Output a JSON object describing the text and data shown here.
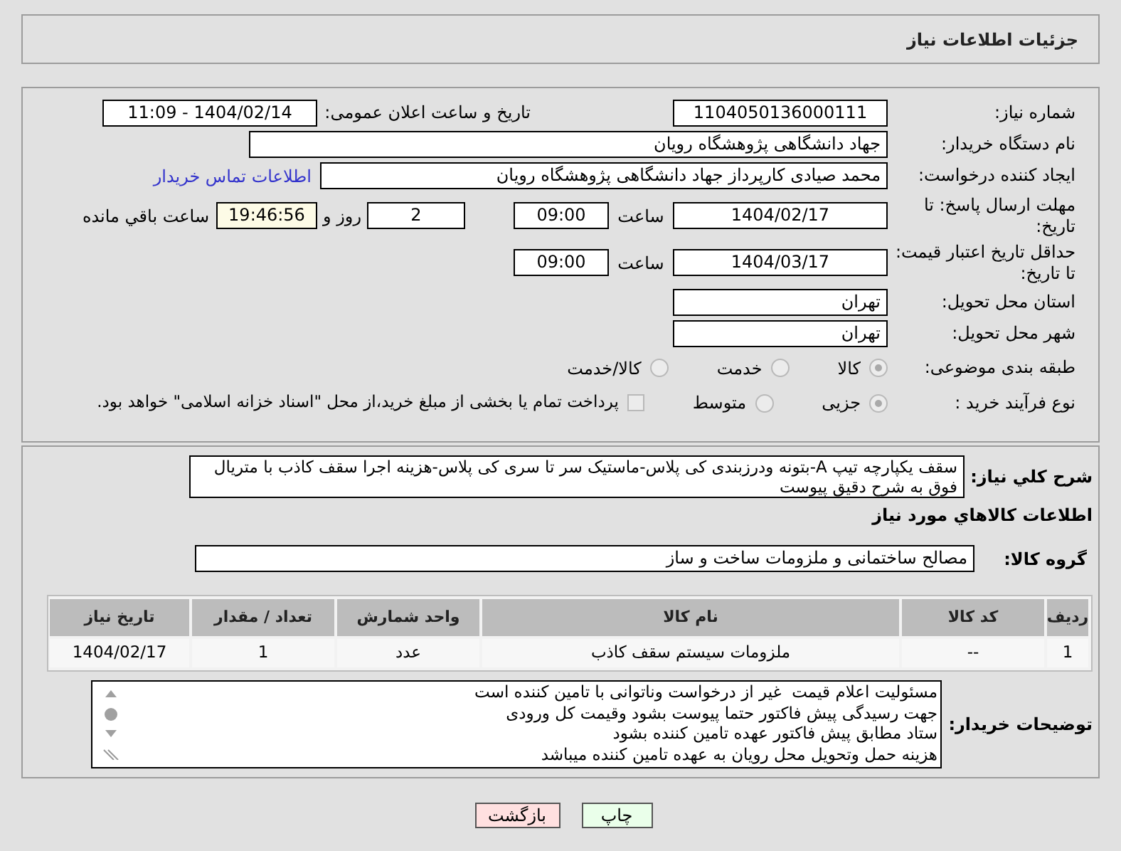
{
  "header": {
    "title": "جزئیات اطلاعات نیاز"
  },
  "need_number": {
    "label": "شماره نیاز:",
    "value": "1104050136000111"
  },
  "announce": {
    "label": "تاریخ و ساعت اعلان عمومی:",
    "value": "1404/02/14 - 11:09"
  },
  "buyer_org": {
    "label": "نام دستگاه خریدار:",
    "value": "جهاد دانشگاهی پژوهشگاه رویان"
  },
  "requester": {
    "label": "ایجاد کننده درخواست:",
    "value": "محمد صیادی کارپرداز جهاد دانشگاهی پژوهشگاه رویان",
    "link": "اطلاعات تماس خریدار"
  },
  "reply_deadline": {
    "label": "مهلت ارسال پاسخ: تا تاریخ:",
    "date": "1404/02/17",
    "time_label": "ساعت",
    "time": "09:00",
    "days": "2",
    "days_label": "روز و",
    "remaining": "19:46:56",
    "remaining_label": "ساعت باقي مانده"
  },
  "price_validity": {
    "label": "حداقل تاریخ اعتبار قیمت: تا تاریخ:",
    "date": "1404/03/17",
    "time_label": "ساعت",
    "time": "09:00"
  },
  "province": {
    "label": "استان محل تحویل:",
    "value": "تهران"
  },
  "city": {
    "label": "شهر محل تحویل:",
    "value": "تهران"
  },
  "category": {
    "label": "طبقه بندی موضوعی:",
    "options": [
      {
        "label": "کالا",
        "selected": true
      },
      {
        "label": "خدمت",
        "selected": false
      },
      {
        "label": "کالا/خدمت",
        "selected": false
      }
    ]
  },
  "process": {
    "label": "نوع فرآیند خرید :",
    "options": [
      {
        "label": "جزیی",
        "selected": true
      },
      {
        "label": "متوسط",
        "selected": false
      }
    ],
    "treasury": {
      "label": "پرداخت تمام یا بخشی از مبلغ خرید،از محل \"اسناد خزانه اسلامی\" خواهد بود.",
      "checked": false
    }
  },
  "description": {
    "label": "شرح کلي نیاز:",
    "value": "سقف یکپارچه تیپ A-بتونه ودرزبندی کی پلاس-ماستیک سر تا سری کی پلاس-هزینه اجرا سقف کاذب با متریال فوق به شرح دقیق پیوست"
  },
  "goods": {
    "title": "اطلاعات کالاهاي مورد نیاز",
    "group_label": "گروه کالا:",
    "group": "مصالح ساختمانی و ملزومات ساخت و ساز",
    "columns": [
      "ردیف",
      "کد کالا",
      "نام کالا",
      "واحد شمارش",
      "تعداد / مقدار",
      "تاریخ نیاز"
    ],
    "rows": [
      [
        "1",
        "--",
        "ملزومات سیستم سقف کاذب",
        "عدد",
        "1",
        "1404/02/17"
      ]
    ]
  },
  "buyer_notes": {
    "label": "توضیحات خریدار:",
    "lines": [
      "مسئولیت اعلام قیمت  غیر از درخواست وناتوانی با تامین کننده است",
      "جهت رسیدگی پیش فاکتور حتما پیوست بشود وقیمت کل ورودی",
      "ستاد مطابق پیش فاکتور عهده تامین کننده بشود",
      "هزینه حمل وتحویل محل رویان به عهده تامین کننده میباشد"
    ]
  },
  "buttons": [
    {
      "label": "چاپ",
      "kind": "print"
    },
    {
      "label": "بازگشت",
      "kind": "back"
    }
  ]
}
